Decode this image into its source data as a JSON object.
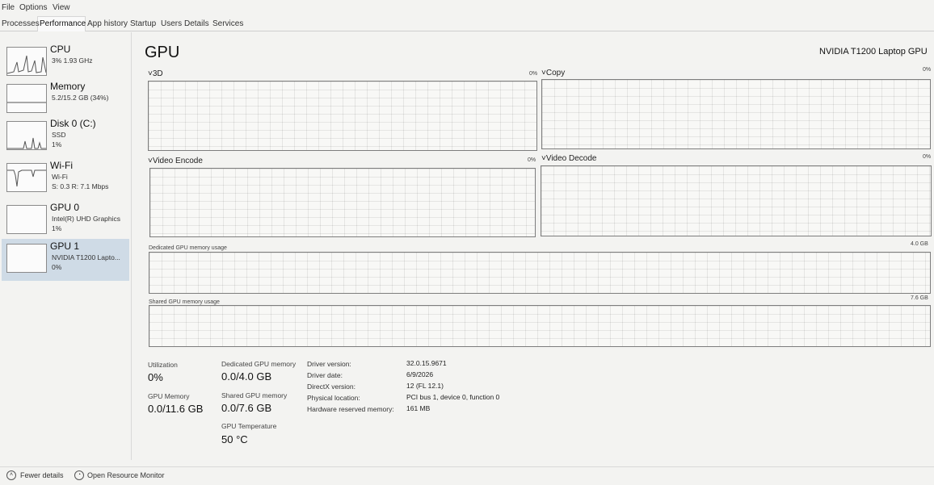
{
  "menu": [
    "File",
    "Options",
    "View"
  ],
  "tabs": [
    "Processes",
    "Performance",
    "App history",
    "Startup",
    "Users",
    "Details",
    "Services"
  ],
  "sidebar": {
    "items": [
      {
        "title": "CPU",
        "line1": "3% 1.93 GHz",
        "line2": ""
      },
      {
        "title": "Memory",
        "line1": "5.2/15.2 GB (34%)",
        "line2": ""
      },
      {
        "title": "Disk 0 (C:)",
        "line1": "SSD",
        "line2": "1%"
      },
      {
        "title": "Wi-Fi",
        "line1": "Wi-Fi",
        "line2": "S: 0.3 R: 7.1 Mbps"
      },
      {
        "title": "GPU 0",
        "line1": "Intel(R) UHD Graphics",
        "line2": "1%"
      },
      {
        "title": "GPU 1",
        "line1": "NVIDIA T1200 Lapto...",
        "line2": "0%"
      }
    ]
  },
  "main": {
    "title": "GPU",
    "device": "NVIDIA T1200 Laptop GPU",
    "graphs": {
      "g3d": {
        "label": "3D",
        "pct": "0%"
      },
      "copy": {
        "label": "Copy",
        "pct": "0%"
      },
      "encode": {
        "label": "Video Encode",
        "pct": "0%"
      },
      "decode": {
        "label": "Video Decode",
        "pct": "0%"
      }
    },
    "dedicated": {
      "label": "Dedicated GPU memory usage",
      "max": "4.0 GB"
    },
    "shared": {
      "label": "Shared GPU memory usage",
      "max": "7.6 GB"
    }
  },
  "stats": {
    "utilization": {
      "label": "Utilization",
      "value": "0%"
    },
    "dedicated": {
      "label": "Dedicated GPU memory",
      "value": "0.0/4.0 GB"
    },
    "gpu_memory": {
      "label": "GPU Memory",
      "value": "0.0/11.6 GB"
    },
    "shared": {
      "label": "Shared GPU memory",
      "value": "0.0/7.6 GB"
    },
    "temperature": {
      "label": "GPU Temperature",
      "value": "50 °C"
    }
  },
  "info": [
    {
      "label": "Driver version:",
      "value": "32.0.15.9671"
    },
    {
      "label": "Driver date:",
      "value": "6/9/2026"
    },
    {
      "label": "DirectX version:",
      "value": "12 (FL 12.1)"
    },
    {
      "label": "Physical location:",
      "value": "PCI bus 1, device 0, function 0"
    },
    {
      "label": "Hardware reserved memory:",
      "value": "161 MB"
    }
  ],
  "footer": {
    "fewer": "Fewer details",
    "monitor": "Open Resource Monitor"
  }
}
